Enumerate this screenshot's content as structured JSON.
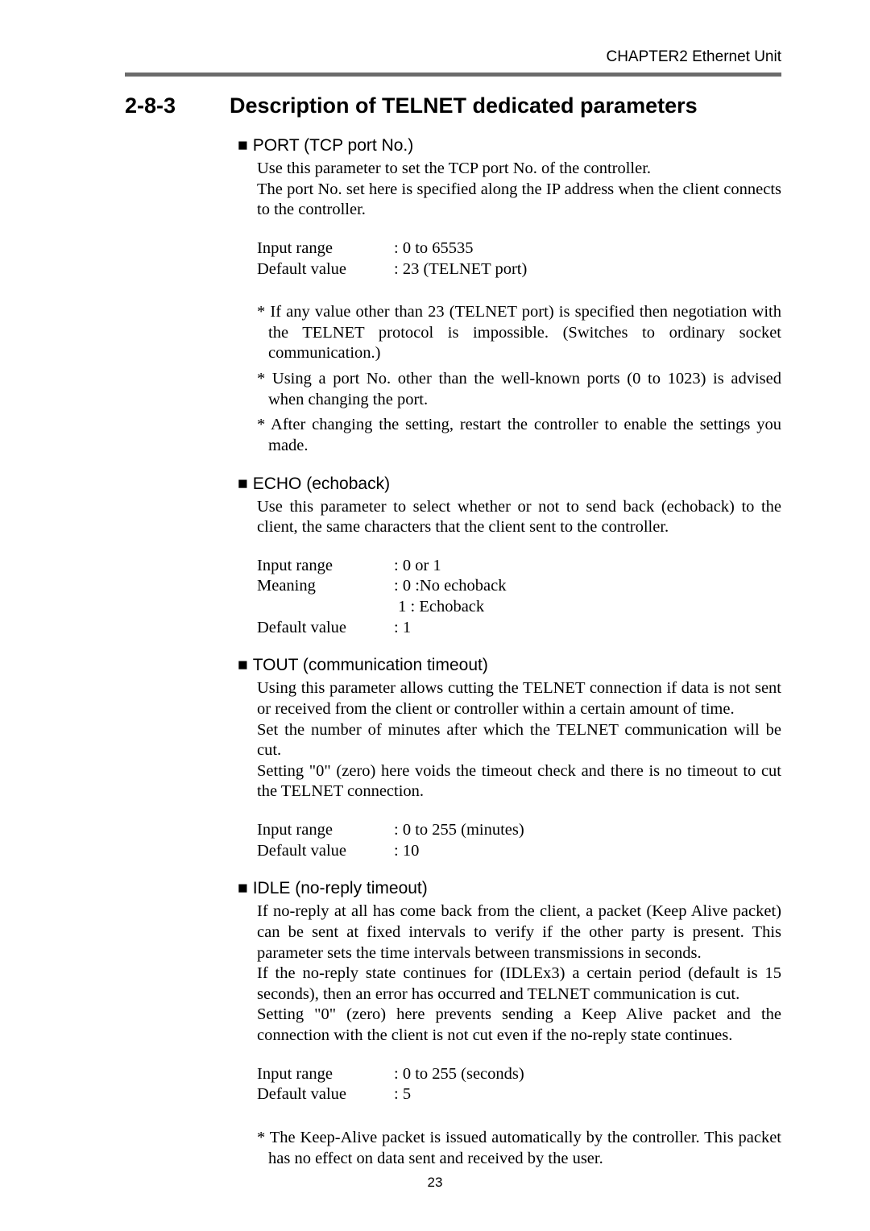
{
  "chapter": "CHAPTER2  Ethernet Unit",
  "page_number": "23",
  "section": {
    "number": "2-8-3",
    "title": "Description of TELNET dedicated parameters"
  },
  "params": {
    "port": {
      "heading": "PORT (TCP port No.)",
      "desc1": "Use this parameter to set the TCP port No. of the controller.",
      "desc2": "The port No. set here is specified along the IP address when the client connects to the controller.",
      "input_label": "Input range",
      "input_val": ": 0 to 65535",
      "default_label": "Default value",
      "default_val": ": 23 (TELNET port)",
      "note1": "* If any value other than 23 (TELNET port) is specified then negotiation with the TELNET protocol is impossible. (Switches to ordinary socket communication.)",
      "note2": "* Using a port No. other than the well-known ports (0 to 1023) is advised when changing the port.",
      "note3": "* After changing the setting, restart the controller to enable the settings you made."
    },
    "echo": {
      "heading": "ECHO (echoback)",
      "desc1": "Use this parameter to select whether or not to send back (echoback) to the client, the same characters that the client sent to the controller.",
      "input_label": "Input range",
      "input_val": ": 0 or 1",
      "meaning_label": "Meaning",
      "meaning_val1": ": 0 :No echoback",
      "meaning_val2": "  1 : Echoback",
      "default_label": "Default value",
      "default_val": ": 1"
    },
    "tout": {
      "heading": "TOUT (communication timeout)",
      "desc1": "Using this parameter allows cutting the TELNET connection if data is not sent or received from the client or controller within a certain amount of time.",
      "desc2": "Set the number of minutes after which the TELNET communication will be cut.",
      "desc3": "Setting \"0\" (zero) here voids the timeout check and there is no timeout to cut the TELNET connection.",
      "input_label": "Input range",
      "input_val": ": 0 to 255 (minutes)",
      "default_label": "Default value",
      "default_val": ": 10"
    },
    "idle": {
      "heading": "IDLE (no-reply timeout)",
      "desc1": "If no-reply at all has come back from the client, a packet (Keep Alive packet) can be sent at fixed intervals to verify if the other party is present. This parameter sets the time intervals between transmissions in seconds.",
      "desc2": "If the no-reply state continues for (IDLEx3) a certain period (default is 15 seconds), then an error has occurred and TELNET communication is cut.",
      "desc3": "Setting \"0\" (zero) here prevents sending a Keep Alive packet and the connection with the client is not cut even if the no-reply state continues.",
      "input_label": "Input range",
      "input_val": ": 0 to 255 (seconds)",
      "default_label": "Default value",
      "default_val": ": 5",
      "note1": "* The Keep-Alive packet is issued automatically by the controller. This packet has no effect on data sent and received by the user."
    }
  }
}
